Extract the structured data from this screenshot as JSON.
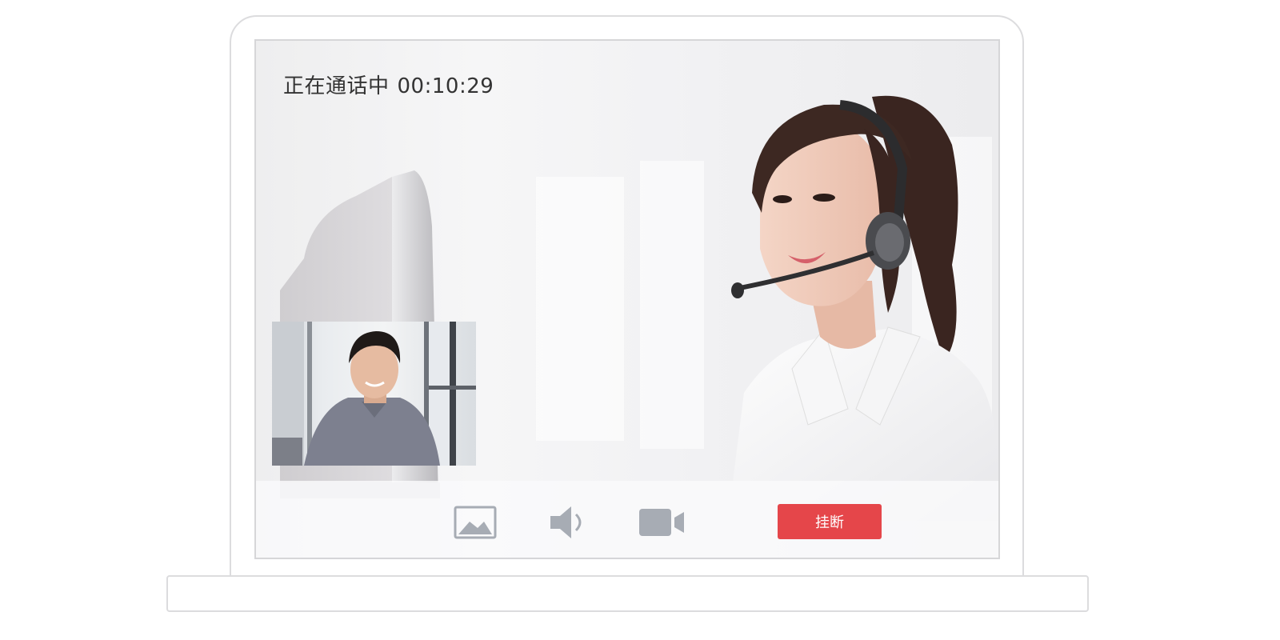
{
  "call": {
    "status_label": "正在通话中",
    "duration": "00:10:29"
  },
  "toolbar": {
    "buttons": [
      {
        "icon": "image-icon"
      },
      {
        "icon": "speaker-icon"
      },
      {
        "icon": "video-camera-icon"
      }
    ],
    "hangup_label": "挂断"
  },
  "colors": {
    "hangup": "#e5464a",
    "icon": "#a7acb4",
    "frame": "#dcdcde"
  }
}
